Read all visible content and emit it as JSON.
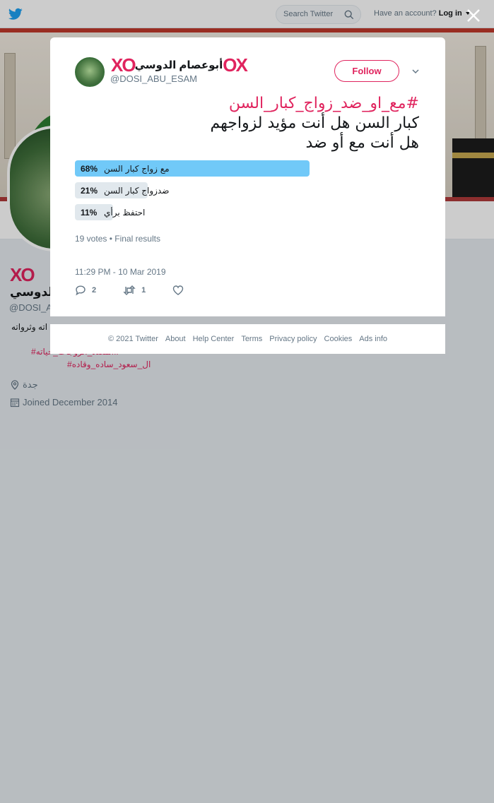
{
  "topbar": {
    "search_placeholder": "Search Twitter",
    "account_prompt": "Have an account?",
    "login_label": "Log in"
  },
  "background_profile": {
    "display_name": "الدوسي",
    "handle": "@DOSI_A",
    "bio_fragment": "اته وثرواته",
    "hashtag_line_1": "#متعدد_الزوجات_حياته...",
    "hashtag_line_2": "#ال_سعود_ساده_وقاده",
    "location": "جدة",
    "joined": "Joined December 2014"
  },
  "tweet": {
    "author_name": "أبوعصام الدوسي",
    "author_mark_left": "XO",
    "author_mark_right": "OX",
    "handle": "@DOSI_ABU_ESAM",
    "follow_label": "Follow",
    "hashtag": "#مع_او_ضد_زواج_كبار_السن",
    "line_1": "كبار السن هل أنت مؤيد لزواجهم",
    "line_2": "هل أنت مع أو ضد",
    "timestamp": "11:29 PM - 10 Mar 2019",
    "reply_count": "2",
    "retweet_count": "1"
  },
  "poll": {
    "options": [
      {
        "percent_label": "68%",
        "label": "مع زواج كبار السن",
        "share": 68,
        "winner": true
      },
      {
        "percent_label": "21%",
        "label": "ضدزواج كبار السن",
        "share": 21,
        "winner": false
      },
      {
        "percent_label": "11%",
        "label": "احتفظ برأي",
        "share": 11,
        "winner": false
      }
    ],
    "votes": "19 votes",
    "separator": "•",
    "status": "Final results"
  },
  "footer": {
    "copyright": "© 2021 Twitter",
    "about": "About",
    "help": "Help Center",
    "terms": "Terms",
    "privacy": "Privacy policy",
    "cookies": "Cookies",
    "ads": "Ads info"
  },
  "colors": {
    "accent": "#e0245e",
    "twitter_blue": "#1da1f2",
    "poll_winner": "#71c9f8",
    "poll_other": "#e1e8ed"
  }
}
